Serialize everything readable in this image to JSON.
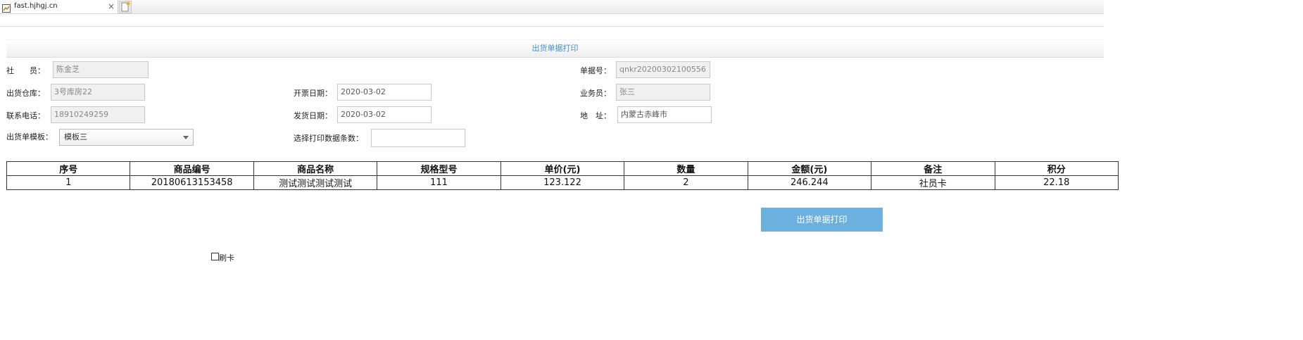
{
  "browser": {
    "tab_title": "fast.hjhgj.cn",
    "close_glyph": "×"
  },
  "panel": {
    "title": "出货单据打印"
  },
  "form": {
    "member_label": "社　　员：",
    "member_value": "陈金芝",
    "receipt_no_label": "单据号：",
    "receipt_no_value": "qnkr20200302100556",
    "warehouse_label": "出货仓库：",
    "warehouse_value": "3号库房22",
    "invoice_date_label": "开票日期：",
    "invoice_date_value": "2020-03-02",
    "salesperson_label": "业务员：",
    "salesperson_value": "张三",
    "phone_label": "联系电话：",
    "phone_value": "18910249259",
    "ship_date_label": "发货日期：",
    "ship_date_value": "2020-03-02",
    "address_label": "地　址：",
    "address_value": "内蒙古赤峰市",
    "template_label": "出货单模板：",
    "template_selected": "模板三",
    "print_count_label": "选择打印数据条数：",
    "print_count_value": ""
  },
  "table": {
    "headers": [
      "序号",
      "商品编号",
      "商品名称",
      "规格型号",
      "单价(元)",
      "数量",
      "金额(元)",
      "备注",
      "积分"
    ],
    "rows": [
      [
        "1",
        "20180613153458",
        "测试测试测试测试",
        "111",
        "123.122",
        "2",
        "246.244",
        "社员卡",
        "22.18"
      ]
    ]
  },
  "actions": {
    "print_button": "出货单据打印",
    "swipe_card_label": "刷卡",
    "swipe_card_checked": false
  },
  "colors": {
    "accent": "#6cb0e0",
    "title_blue": "#3e8ec9",
    "readonly_bg": "#f0f0f0"
  }
}
